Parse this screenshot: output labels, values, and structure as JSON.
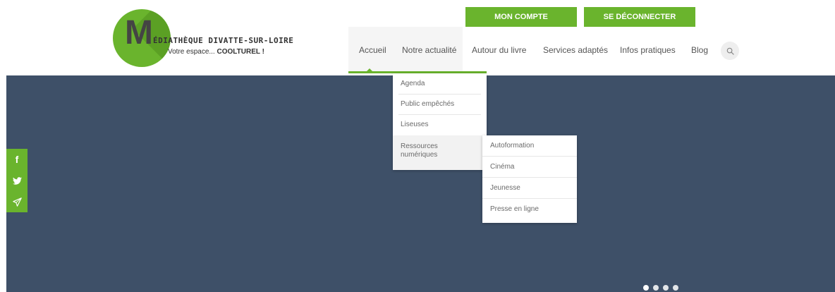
{
  "logo": {
    "letter": "M",
    "title": "ÉDIATHÈQUE DIVATTE-SUR-LOIRE",
    "tagline_prefix": "Votre espace...",
    "tagline_bold": "COOLTUREL !"
  },
  "top_buttons": {
    "account": "MON COMPTE",
    "logout": "SE DÉCONNECTER"
  },
  "nav": {
    "items": [
      "Accueil",
      "Notre actualité",
      "Autour du livre",
      "Services adaptés",
      "Infos pratiques",
      "Blog"
    ],
    "active": "Accueil"
  },
  "dropdown": {
    "items": [
      "Agenda",
      "Public empêchés",
      "Liseuses"
    ],
    "ressources_line1": "Ressources",
    "ressources_line2": "numériques",
    "submenu": [
      "Autoformation",
      "Cinéma",
      "Jeunesse",
      "Presse en ligne"
    ]
  },
  "social": {
    "icons": [
      "facebook-icon",
      "twitter-icon",
      "paper-plane-icon"
    ],
    "facebook_glyph": "f"
  },
  "slider": {
    "dot_count": 4,
    "active_index": 0
  },
  "colors": {
    "accent_green": "#6ab42d",
    "hero_bg": "#3e5068",
    "menu_text": "#6a6a6a"
  }
}
